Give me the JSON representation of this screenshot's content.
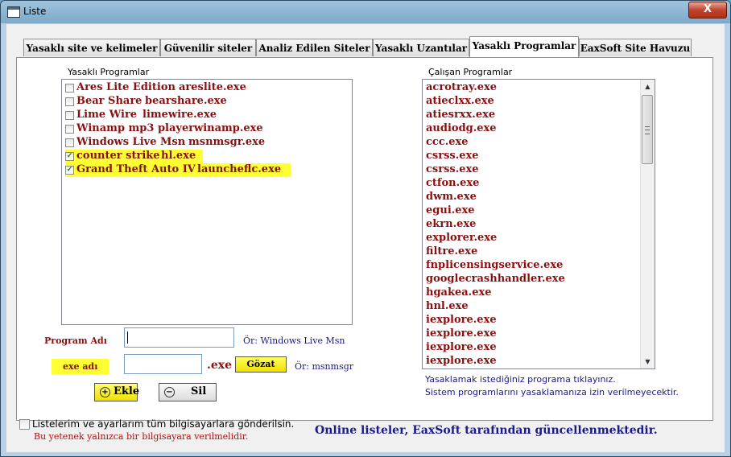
{
  "window": {
    "title": "Liste",
    "close_label": "X"
  },
  "tabs": [
    {
      "label": "Yasaklı site ve kelimeler",
      "active": false
    },
    {
      "label": "Güvenilir siteler",
      "active": false
    },
    {
      "label": "Analiz Edilen Siteler",
      "active": false
    },
    {
      "label": "Yasaklı Uzantılar",
      "active": false
    },
    {
      "label": "Yasaklı Programlar",
      "active": true
    },
    {
      "label": "EaxSoft Site Havuzu",
      "active": false
    }
  ],
  "banned": {
    "title": "Yasaklı Programlar",
    "items": [
      {
        "name": "Ares Lite Edition",
        "exe": "areslite.exe",
        "checked": false,
        "highlight": false
      },
      {
        "name": "Bear Share",
        "exe": "bearshare.exe",
        "checked": false,
        "highlight": false
      },
      {
        "name": "Lime Wire",
        "exe": "limewire.exe",
        "checked": false,
        "highlight": false
      },
      {
        "name": "Winamp mp3 player",
        "exe": "winamp.exe",
        "checked": false,
        "highlight": false
      },
      {
        "name": "Windows Live Msn",
        "exe": "msnmsgr.exe",
        "checked": false,
        "highlight": false
      },
      {
        "name": "counter strike",
        "exe": "hl.exe",
        "checked": true,
        "highlight": true
      },
      {
        "name": "Grand Theft Auto IV",
        "exe": "launcheflc.exe",
        "checked": true,
        "highlight": true
      }
    ]
  },
  "running": {
    "title": "Çalışan Programlar",
    "items": [
      "acrotray.exe",
      "atieclxx.exe",
      "atiesrxx.exe",
      "audiodg.exe",
      "ccc.exe",
      "csrss.exe",
      "csrss.exe",
      "ctfon.exe",
      "dwm.exe",
      "egui.exe",
      "ekrn.exe",
      "explorer.exe",
      "filtre.exe",
      "fnplicensingservice.exe",
      "googlecrashhandler.exe",
      "hgakea.exe",
      "hnl.exe",
      "iexplore.exe",
      "iexplore.exe",
      "iexplore.exe",
      "iexplore.exe"
    ],
    "info_line1": "Yasaklamak istediğiniz programa tıklayınız.",
    "info_line2": "Sistem programlarını yasaklamanıza izin verilmeyecektir."
  },
  "form": {
    "program_label": "Program Adı",
    "program_value": "",
    "program_hint": "Ör: Windows Live Msn",
    "exe_label": "exe adı",
    "exe_value": "",
    "exe_suffix": ".exe",
    "browse_label": "Gözat",
    "exe_hint": "Ör: msnmsgr",
    "add_label": "Ekle",
    "add_icon": "+",
    "delete_label": "Sil",
    "delete_icon": "−"
  },
  "footer": {
    "share_label": "Listelerim ve ayarlarım tüm bilgisayarlara gönderilsin.",
    "share_checked": false,
    "warning": "Bu yetenek yalnızca bir bilgisayara verilmelidir.",
    "online": "Online listeler, EaxSoft tarafından güncellenmektedir."
  },
  "colors": {
    "highlight": "#ffff33",
    "item_text": "#8a1010",
    "info_text": "#1a1a8a"
  }
}
